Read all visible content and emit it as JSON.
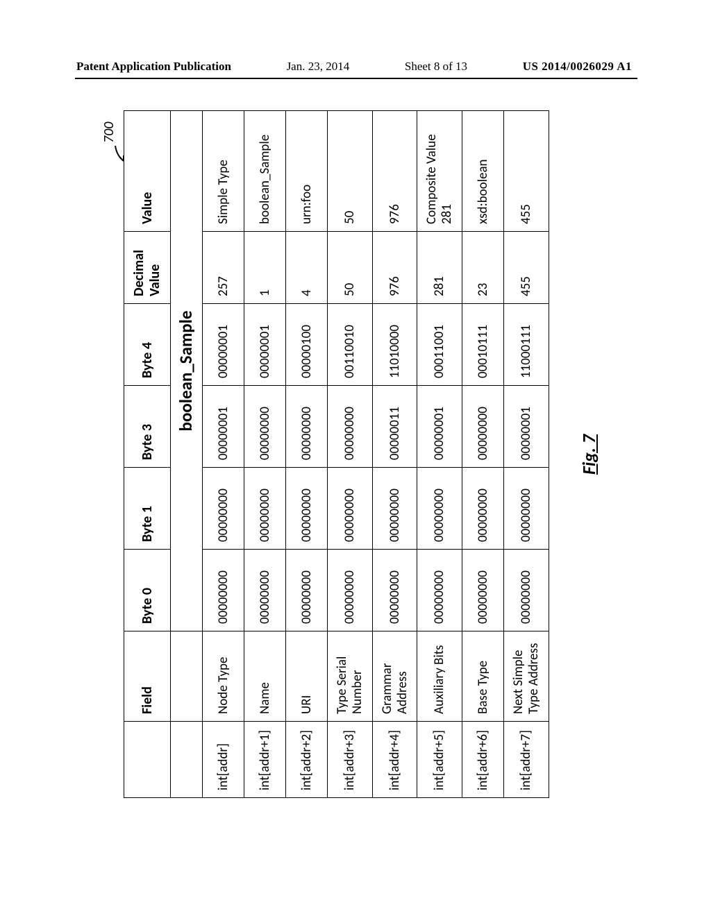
{
  "header": {
    "publication": "Patent Application Publication",
    "date": "Jan. 23, 2014",
    "sheet": "Sheet 8 of 13",
    "docnum": "US 2014/0026029 A1"
  },
  "figure": {
    "refnum": "700",
    "caption": "Fig. 7",
    "title": "boolean_Sample",
    "columns": {
      "addr": "",
      "field": "Field",
      "byte0": "Byte 0",
      "byte1": "Byte 1",
      "byte3": "Byte 3",
      "byte4": "Byte 4",
      "decimal": "Decimal Value",
      "value": "Value"
    },
    "rows": [
      {
        "addr": "int[addr]",
        "field": "Node Type",
        "b0": "00000000",
        "b1": "00000000",
        "b3": "00000001",
        "b4": "00000001",
        "dec": "257",
        "val": "Simple Type"
      },
      {
        "addr": "int[addr+1]",
        "field": "Name",
        "b0": "00000000",
        "b1": "00000000",
        "b3": "00000000",
        "b4": "00000001",
        "dec": "1",
        "val": "boolean_Sample"
      },
      {
        "addr": "int[addr+2]",
        "field": "URI",
        "b0": "00000000",
        "b1": "00000000",
        "b3": "00000000",
        "b4": "00000100",
        "dec": "4",
        "val": "urn:foo"
      },
      {
        "addr": "int[addr+3]",
        "field": "Type Serial Number",
        "b0": "00000000",
        "b1": "00000000",
        "b3": "00000000",
        "b4": "00110010",
        "dec": "50",
        "val": "50"
      },
      {
        "addr": "int[addr+4]",
        "field": "Grammar Address",
        "b0": "00000000",
        "b1": "00000000",
        "b3": "00000011",
        "b4": "11010000",
        "dec": "976",
        "val": "976"
      },
      {
        "addr": "int[addr+5]",
        "field": "Auxiliary Bits",
        "b0": "00000000",
        "b1": "00000000",
        "b3": "00000001",
        "b4": "00011001",
        "dec": "281",
        "val": "Composite Value 281"
      },
      {
        "addr": "int[addr+6]",
        "field": "Base Type",
        "b0": "00000000",
        "b1": "00000000",
        "b3": "00000000",
        "b4": "00010111",
        "dec": "23",
        "val": "xsd:boolean"
      },
      {
        "addr": "int[addr+7]",
        "field": "Next Simple Type Address",
        "b0": "00000000",
        "b1": "00000000",
        "b3": "00000001",
        "b4": "11000111",
        "dec": "455",
        "val": "455"
      }
    ]
  }
}
